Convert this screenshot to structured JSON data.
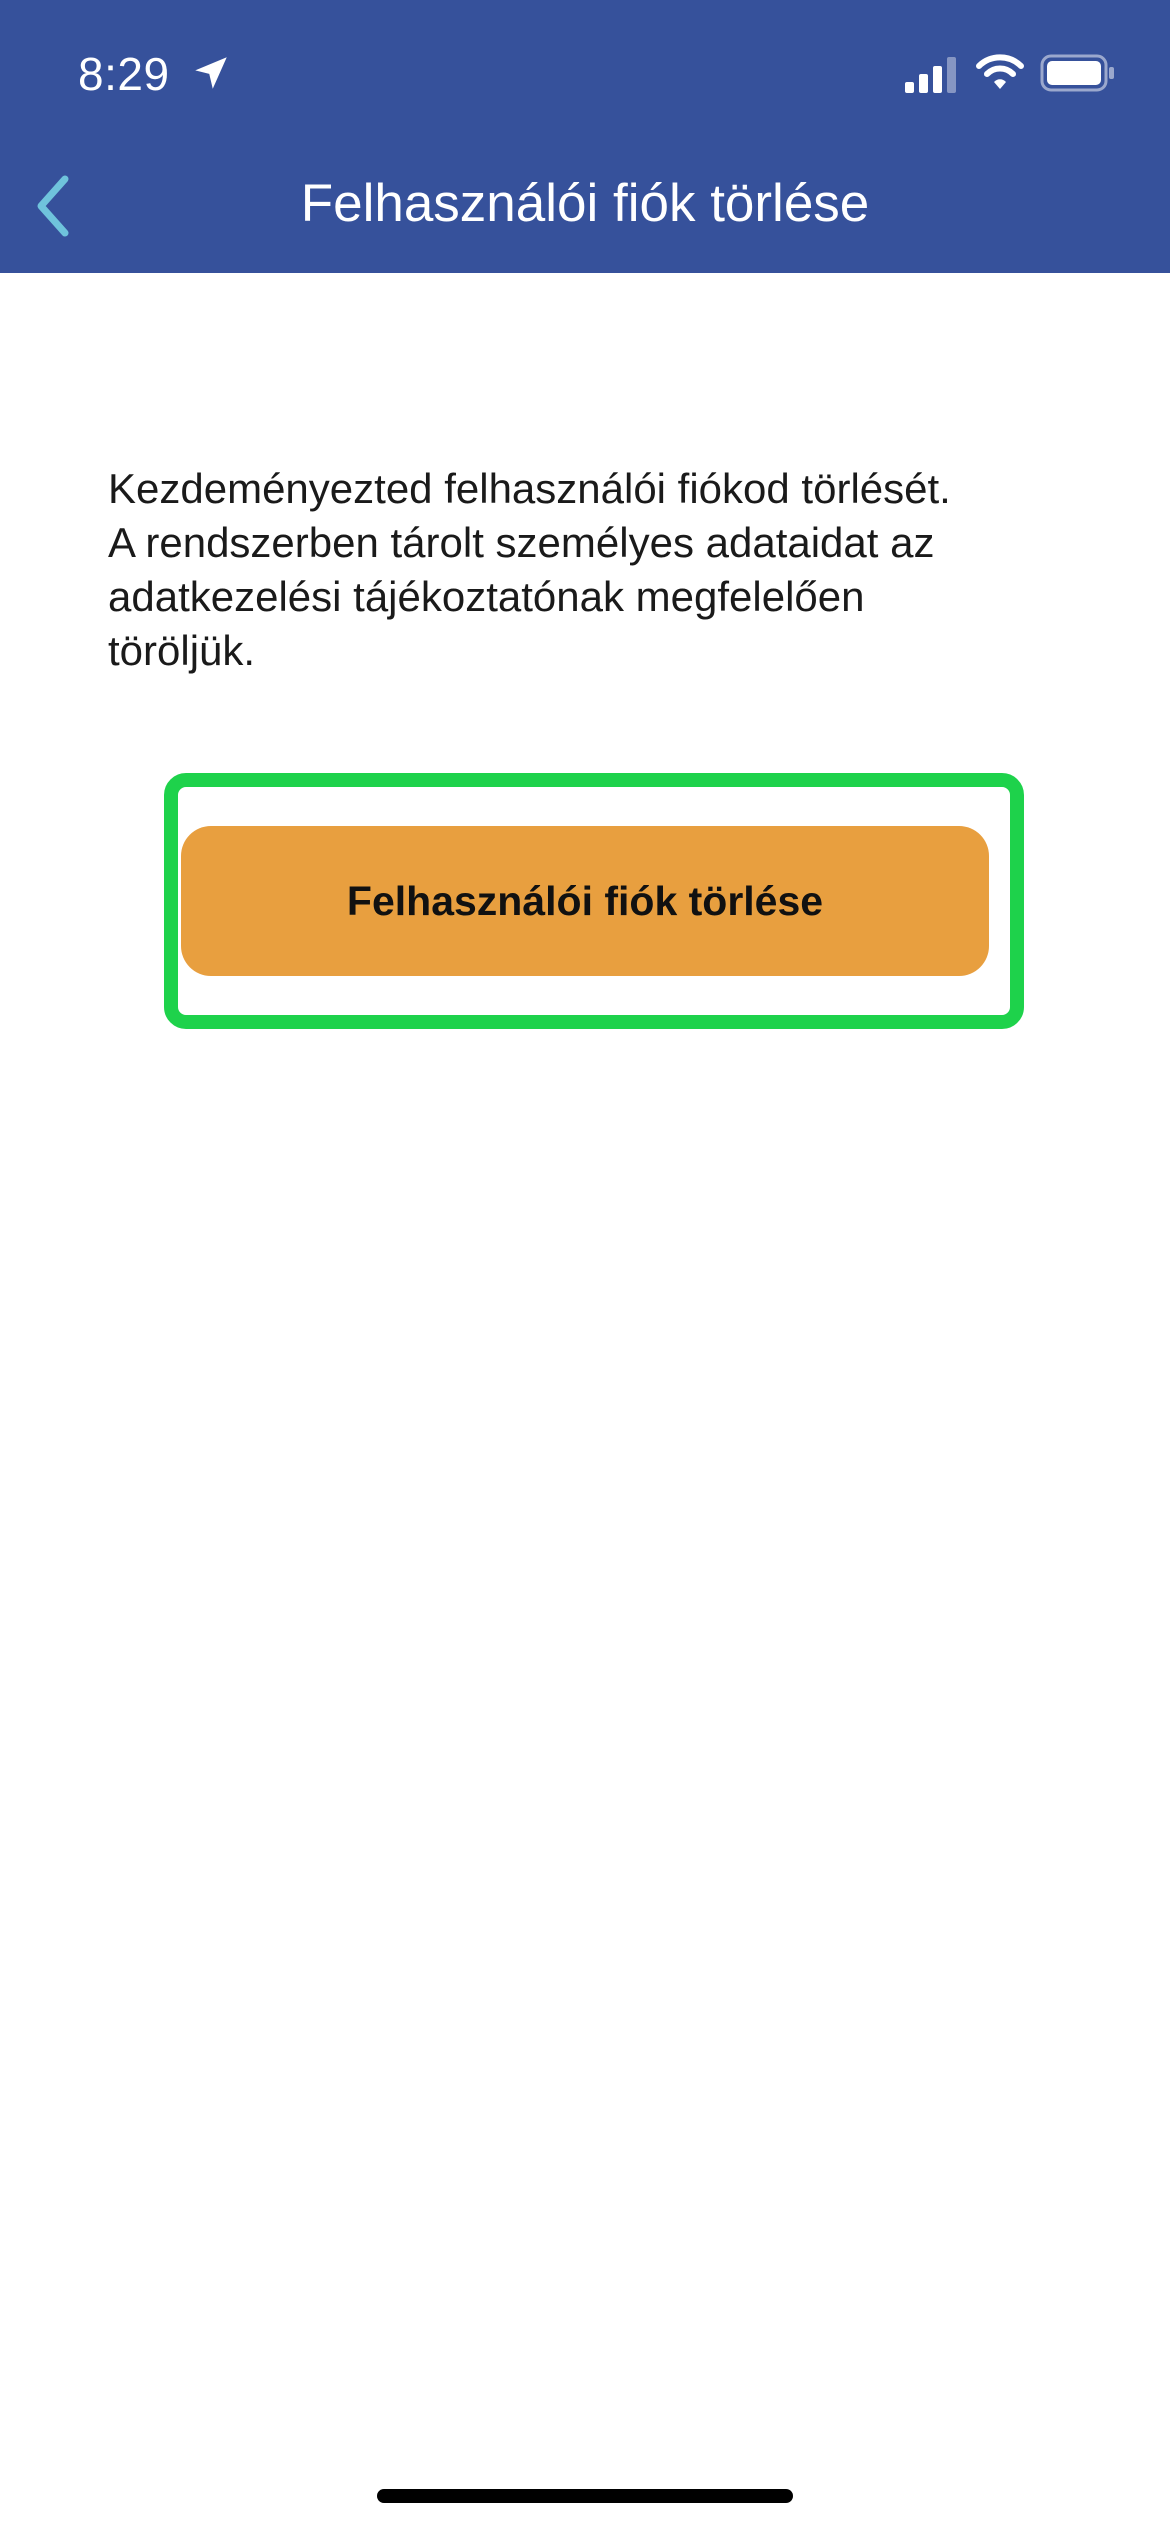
{
  "status_bar": {
    "time": "8:29",
    "location_icon": "location-arrow-icon",
    "signal_icon": "cellular-signal-icon",
    "wifi_icon": "wifi-icon",
    "battery_icon": "battery-icon"
  },
  "nav": {
    "back_icon": "chevron-left-icon",
    "title": "Felhasználói fiók törlése"
  },
  "content": {
    "message_lines": [
      "Kezdeményezted felhasználói fiókod törlését.",
      "A rendszerben tárolt személyes adataidat az",
      "adatkezelési tájékoztatónak megfelelően",
      "töröljük."
    ]
  },
  "actions": {
    "delete_label": "Felhasználói fiók törlése"
  },
  "colors": {
    "header": "#36519b",
    "back_chevron": "#6fc3dc",
    "button": "#e89f3f",
    "highlight": "#1ed24b"
  }
}
